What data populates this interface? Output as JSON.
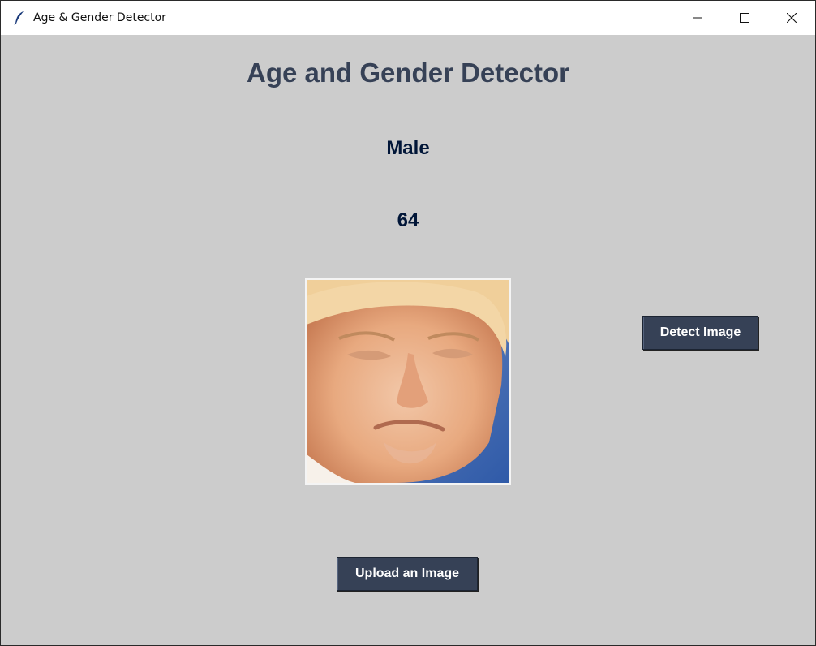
{
  "window": {
    "title": "Age & Gender Detector",
    "icon": "feather-icon",
    "controls": [
      "minimize-icon",
      "maximize-icon",
      "close-icon"
    ]
  },
  "main": {
    "heading": "Age and Gender Detector",
    "gender_result": "Male",
    "age_result": "64",
    "image_subject": "uploaded-face-photo",
    "detect_button": "Detect Image",
    "upload_button": "Upload an Image"
  },
  "colors": {
    "background": "#cccccc",
    "heading": "#364156",
    "result_text": "#011638",
    "button_bg": "#364156",
    "button_text": "#ffffff"
  }
}
